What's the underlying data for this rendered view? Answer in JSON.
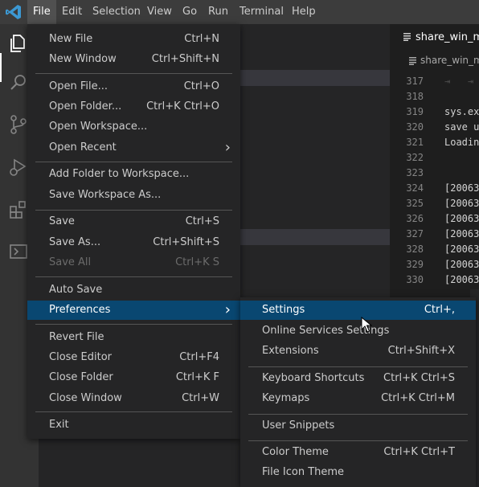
{
  "menubar": {
    "items": [
      "File",
      "Edit",
      "Selection",
      "View",
      "Go",
      "Run",
      "Terminal",
      "Help"
    ]
  },
  "activity_icons": [
    "explorer-icon",
    "search-icon",
    "source-control-icon",
    "run-debug-icon",
    "extensions-icon",
    "remote-explorer-icon"
  ],
  "editor": {
    "tab_label": "share_win_ma",
    "breadcrumb": "share_win_m",
    "lines": [
      {
        "num": "317",
        "text": "⇥   ⇥"
      },
      {
        "num": "318",
        "text": ""
      },
      {
        "num": "319",
        "text": "sys.ex"
      },
      {
        "num": "320",
        "text": "save u"
      },
      {
        "num": "321",
        "text": "Loadin"
      },
      {
        "num": "322",
        "text": ""
      },
      {
        "num": "323",
        "text": ""
      },
      {
        "num": "324",
        "text": "[20063"
      },
      {
        "num": "325",
        "text": "[20063"
      },
      {
        "num": "326",
        "text": "[20063"
      },
      {
        "num": "327",
        "text": "[20063"
      },
      {
        "num": "328",
        "text": "[20063"
      },
      {
        "num": "329",
        "text": "[20063"
      },
      {
        "num": "330",
        "text": "[20063"
      }
    ]
  },
  "file_menu": {
    "items": [
      {
        "label": "New File",
        "key": "Ctrl+N"
      },
      {
        "label": "New Window",
        "key": "Ctrl+Shift+N"
      },
      {
        "label": "Open File...",
        "key": "Ctrl+O"
      },
      {
        "label": "Open Folder...",
        "key": "Ctrl+K Ctrl+O"
      },
      {
        "label": "Open Workspace...",
        "key": ""
      },
      {
        "label": "Open Recent",
        "key": ""
      },
      {
        "label": "Add Folder to Workspace...",
        "key": ""
      },
      {
        "label": "Save Workspace As...",
        "key": ""
      },
      {
        "label": "Save",
        "key": "Ctrl+S"
      },
      {
        "label": "Save As...",
        "key": "Ctrl+Shift+S"
      },
      {
        "label": "Save All",
        "key": "Ctrl+K S"
      },
      {
        "label": "Auto Save",
        "key": ""
      },
      {
        "label": "Preferences",
        "key": ""
      },
      {
        "label": "Revert File",
        "key": ""
      },
      {
        "label": "Close Editor",
        "key": "Ctrl+F4"
      },
      {
        "label": "Close Folder",
        "key": "Ctrl+K F"
      },
      {
        "label": "Close Window",
        "key": "Ctrl+W"
      },
      {
        "label": "Exit",
        "key": ""
      }
    ]
  },
  "preferences_menu": {
    "items": [
      {
        "label": "Settings",
        "key": "Ctrl+,"
      },
      {
        "label": "Online Services Settings",
        "key": ""
      },
      {
        "label": "Extensions",
        "key": "Ctrl+Shift+X"
      },
      {
        "label": "Keyboard Shortcuts",
        "key": "Ctrl+K Ctrl+S"
      },
      {
        "label": "Keymaps",
        "key": "Ctrl+K Ctrl+M"
      },
      {
        "label": "User Snippets",
        "key": ""
      },
      {
        "label": "Color Theme",
        "key": "Ctrl+K Ctrl+T"
      },
      {
        "label": "File Icon Theme",
        "key": ""
      }
    ]
  },
  "colors": {
    "menu_highlight": "#094771",
    "menubar_bg": "#3c3c3c",
    "menu_bg": "#252526",
    "vscode_blue": "#3c99d4"
  }
}
